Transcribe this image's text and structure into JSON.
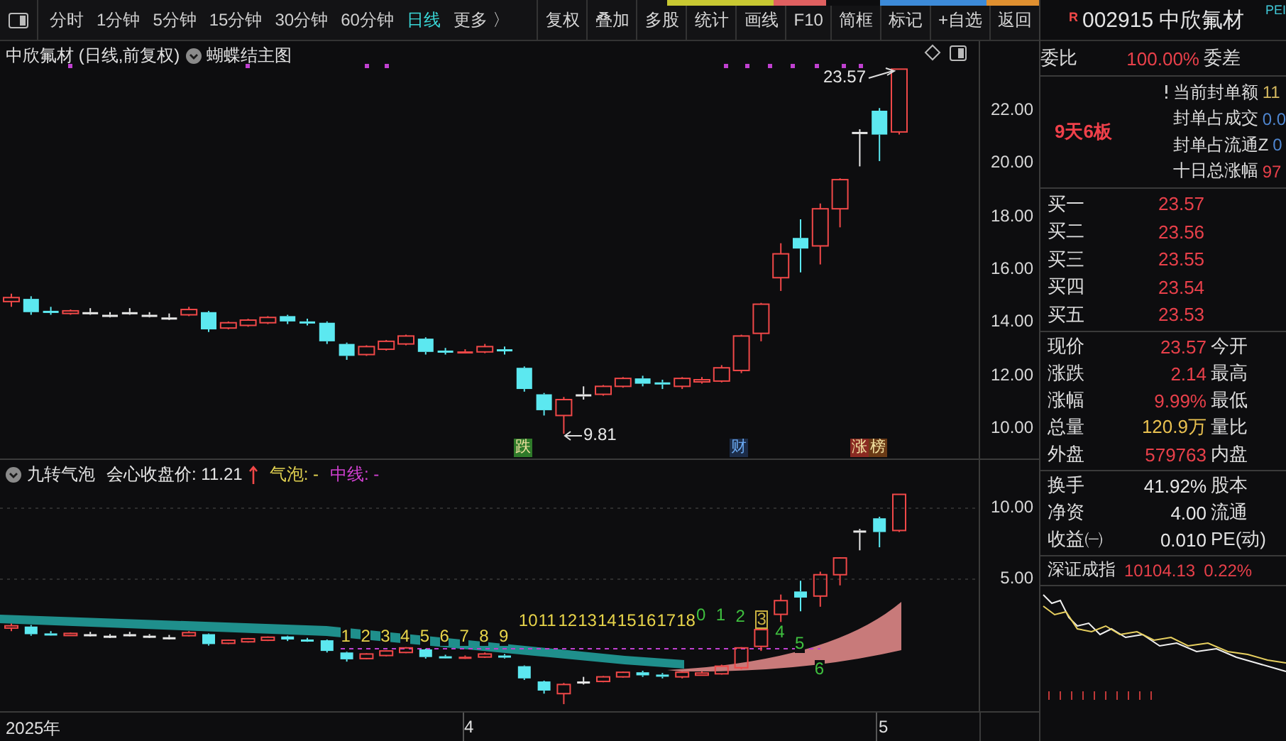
{
  "toolbar": {
    "periods": [
      {
        "label": "分时",
        "selected": false
      },
      {
        "label": "1分钟",
        "selected": false
      },
      {
        "label": "5分钟",
        "selected": false
      },
      {
        "label": "15分钟",
        "selected": false
      },
      {
        "label": "30分钟",
        "selected": false
      },
      {
        "label": "60分钟",
        "selected": false
      },
      {
        "label": "日线",
        "selected": true
      },
      {
        "label": "更多 〉",
        "selected": false
      }
    ],
    "buttons": [
      "复权",
      "叠加",
      "多股",
      "统计",
      "画线",
      "F10",
      "简框",
      "标记",
      "+自选",
      "返回"
    ]
  },
  "main_chart": {
    "title": "中欣氟材 (日线,前复权)",
    "template": "蝴蝶结主图",
    "price_labels": [
      "22.00",
      "20.00",
      "18.00",
      "16.00",
      "14.00",
      "12.00",
      "10.00"
    ],
    "high_label": "23.57",
    "low_label": "9.81",
    "markers": [
      {
        "text": "跌",
        "color": "#2f7a2a"
      },
      {
        "text": "财",
        "color": "#1c2c48"
      },
      {
        "text": "涨",
        "color": "#8a2a22"
      },
      {
        "text": "榜",
        "color": "#6a3a16"
      }
    ]
  },
  "indicator": {
    "name": "九转气泡",
    "items": [
      {
        "text": "会心收盘价: 11.21",
        "color": "#e6e6e6",
        "arrow": true
      },
      {
        "text": "气泡: -",
        "color": "#e0d050",
        "arrow": false
      },
      {
        "text": "中线: -",
        "color": "#d040d0",
        "arrow": false
      }
    ],
    "axis_labels": [
      "10.00",
      "5.00"
    ],
    "counts": [
      {
        "text": "1",
        "color": "#e8d44a",
        "boxed": false
      },
      {
        "text": "2",
        "color": "#e8d44a",
        "boxed": false
      },
      {
        "text": "3",
        "color": "#e8d44a",
        "boxed": false
      },
      {
        "text": "4",
        "color": "#e8d44a",
        "boxed": false
      },
      {
        "text": "5",
        "color": "#e8d44a",
        "boxed": false
      },
      {
        "text": "6",
        "color": "#e8d44a",
        "boxed": false
      },
      {
        "text": "7",
        "color": "#e8d44a",
        "boxed": false
      },
      {
        "text": "8",
        "color": "#e8d44a",
        "boxed": false
      },
      {
        "text": "9",
        "color": "#e8d44a",
        "boxed": false
      },
      {
        "text": "10",
        "color": "#e8d44a",
        "boxed": false
      },
      {
        "text": "11",
        "color": "#e8d44a",
        "boxed": false
      },
      {
        "text": "12",
        "color": "#e8d44a",
        "boxed": false
      },
      {
        "text": "13",
        "color": "#e8d44a",
        "boxed": false
      },
      {
        "text": "14",
        "color": "#e8d44a",
        "boxed": false
      },
      {
        "text": "15",
        "color": "#e8d44a",
        "boxed": false
      },
      {
        "text": "16",
        "color": "#e8d44a",
        "boxed": false
      },
      {
        "text": "17",
        "color": "#e8d44a",
        "boxed": false
      },
      {
        "text": "18",
        "color": "#e8d44a",
        "boxed": false
      },
      {
        "text": "0",
        "color": "#3fc03f",
        "boxed": false
      },
      {
        "text": "1",
        "color": "#3fc03f",
        "boxed": false
      },
      {
        "text": "2",
        "color": "#3fc03f",
        "boxed": false
      },
      {
        "text": "3",
        "color": "#c8b040",
        "boxed": true
      },
      {
        "text": "4",
        "color": "#3fc03f",
        "boxed": false
      },
      {
        "text": "5",
        "color": "#3fc03f",
        "boxed": false
      },
      {
        "text": "6",
        "color": "#3fc03f",
        "boxed": false
      }
    ]
  },
  "date_labels": [
    "2025年",
    "4",
    "5"
  ],
  "quote": {
    "flag": "R",
    "code": "002915",
    "name": "中欣氟材",
    "tag": "PEI",
    "ratio": {
      "label": "委比",
      "value": "100.00%",
      "label2": "委差"
    },
    "streak": "9天6板",
    "seal": [
      {
        "label": "当前封单额",
        "value": "11",
        "color": "#d4b860",
        "alert": true
      },
      {
        "label": "封单占成交",
        "value": "0.0",
        "color": "#4f86d0",
        "alert": false
      },
      {
        "label": "封单占流通Z",
        "value": "0",
        "color": "#4f86d0",
        "alert": false
      },
      {
        "label": "十日总涨幅",
        "value": "97",
        "color": "#e8404a",
        "alert": false
      }
    ],
    "bids": [
      {
        "label": "买一",
        "price": "23.57"
      },
      {
        "label": "买二",
        "price": "23.56"
      },
      {
        "label": "买三",
        "price": "23.55"
      },
      {
        "label": "买四",
        "price": "23.54"
      },
      {
        "label": "买五",
        "price": "23.53"
      }
    ],
    "stats": [
      {
        "label": "现价",
        "value": "23.57",
        "label2": "今开",
        "color": "#e8404a"
      },
      {
        "label": "涨跌",
        "value": "2.14",
        "label2": "最高",
        "color": "#e8404a"
      },
      {
        "label": "涨幅",
        "value": "9.99%",
        "label2": "最低",
        "color": "#e8404a"
      },
      {
        "label": "总量",
        "value": "120.9万",
        "label2": "量比",
        "color": "#e8c050"
      },
      {
        "label": "外盘",
        "value": "579763",
        "label2": "内盘",
        "color": "#e8404a"
      }
    ],
    "stats2": [
      {
        "label": "换手",
        "value": "41.92%",
        "label2": "股本",
        "color": "#e6e6e6"
      },
      {
        "label": "净资",
        "value": "4.00",
        "label2": "流通",
        "color": "#e6e6e6"
      },
      {
        "label": "收益㈠",
        "value": "0.010",
        "label2": "PE(动)",
        "color": "#e6e6e6"
      }
    ],
    "index": {
      "name": "深证成指",
      "value": "10104.13",
      "change": "0.22%"
    }
  }
}
